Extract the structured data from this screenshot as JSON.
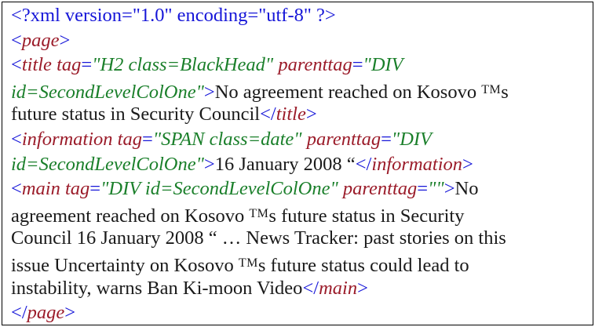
{
  "xml_decl": "<?xml version=\"1.0\" encoding=\"utf-8\" ?>",
  "page_open": {
    "lt": "<",
    "tag": "page",
    "gt": ">"
  },
  "title": {
    "lt": "<",
    "tag": "title",
    "attr1_name": "tag",
    "eq": "=",
    "attr1_value_part1": "\"H2 class=BlackHead\"",
    "attr2_name": "parenttag",
    "attr2_value_part1": "\"DIV",
    "attr2_value_part2": "id=SecondLevelColOne\"",
    "gt": ">",
    "text_line1": "No agreement reached on Kosovo ",
    "tm": "TM",
    "text_line1_end": "s",
    "text_line2": "future status in Security Council",
    "close_lt": "</",
    "close_tag": "title",
    "close_gt": ">"
  },
  "information": {
    "lt": "<",
    "tag": "information",
    "attr1_name": "tag",
    "eq": "=",
    "attr1_value": "\"SPAN class=date\"",
    "attr2_name": "parenttag",
    "attr2_value_part1": "\"DIV",
    "attr2_value_part2": "id=SecondLevelColOne\"",
    "gt": ">",
    "text": "16 January 2008 “",
    "close_lt": "</",
    "close_tag": "information",
    "close_gt": ">"
  },
  "main": {
    "lt": "<",
    "tag": "main",
    "attr1_name": "tag",
    "eq": "=",
    "attr1_value": "\"DIV id=SecondLevelColOne\"",
    "attr2_name": "parenttag",
    "attr2_value": "\"\"",
    "gt": ">",
    "text_line1": "No",
    "text_line2_a": "agreement reached on Kosovo ",
    "tm": "TM",
    "text_line2_b": "s future status in Security",
    "text_line3": "Council 16 January 2008 “ … News Tracker: past stories on this",
    "text_line4_a": "issue Uncertainty on Kosovo ",
    "text_line4_b": "s future status could lead to",
    "text_line5": "instability, warns Ban Ki-moon Video",
    "close_lt": "</",
    "close_tag": "main",
    "close_gt": ">"
  },
  "page_close": {
    "lt": "</",
    "tag": "page",
    "gt": ">"
  }
}
